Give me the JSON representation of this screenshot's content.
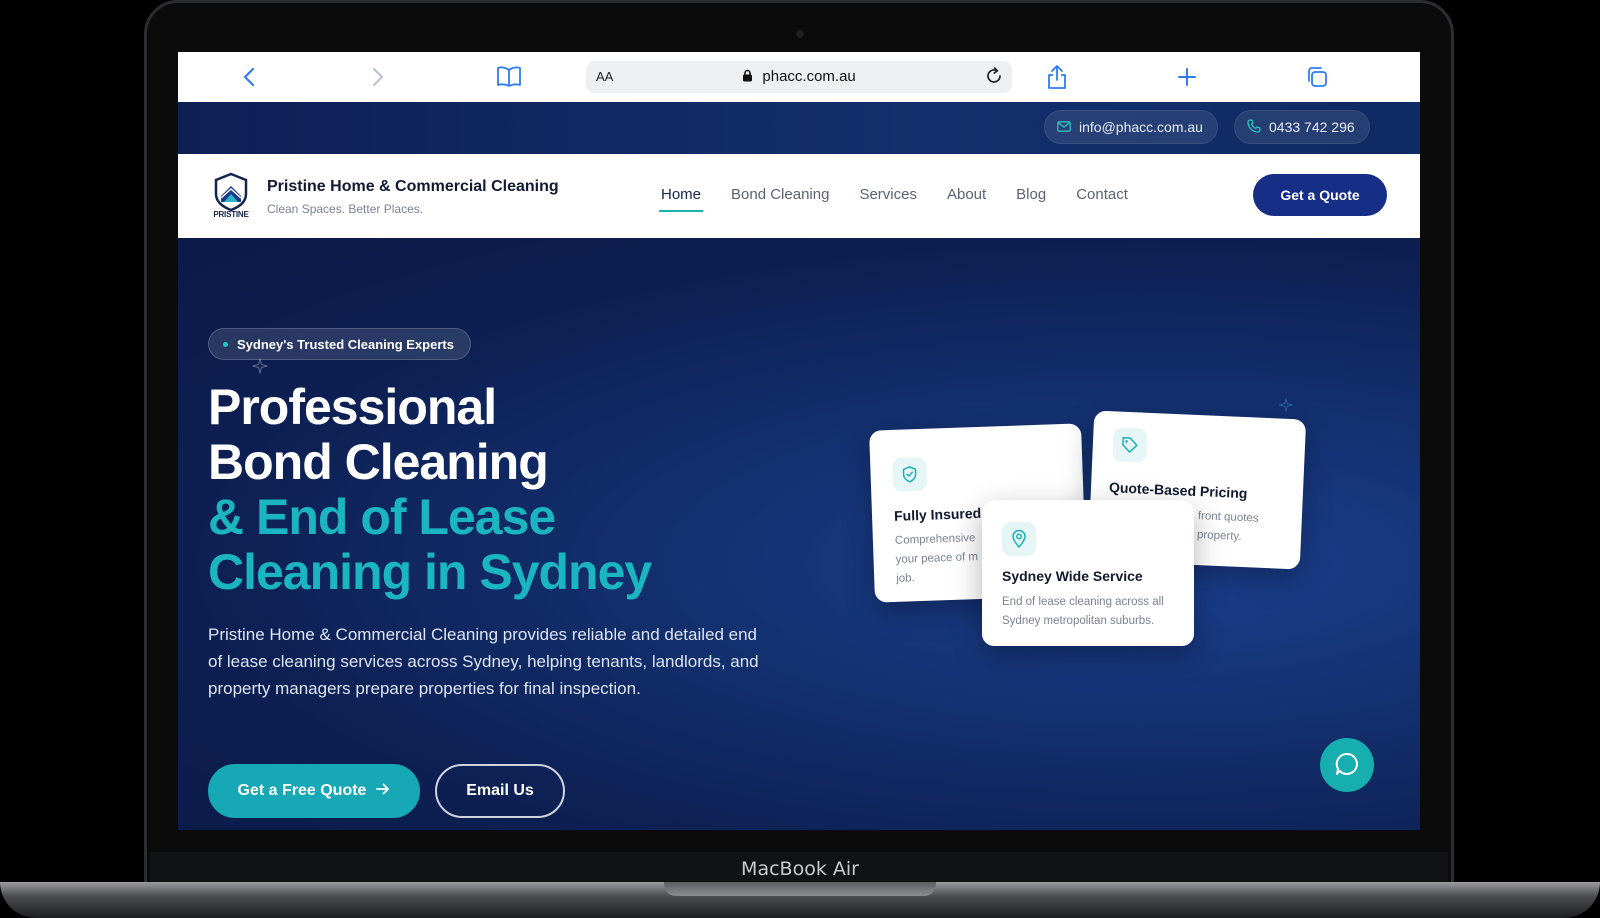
{
  "device": {
    "label": "MacBook Air"
  },
  "browser": {
    "aa_label": "AA",
    "url": "phacc.com.au"
  },
  "topbar": {
    "email": "info@phacc.com.au",
    "phone": "0433 742 296"
  },
  "nav": {
    "brand": "Pristine Home & Commercial Cleaning",
    "tagline": "Clean Spaces. Better Places.",
    "logo_text": "PRISTINE",
    "items": [
      "Home",
      "Bond Cleaning",
      "Services",
      "About",
      "Blog",
      "Contact"
    ],
    "active_item": "Home",
    "cta": "Get a Quote"
  },
  "hero": {
    "badge": "Sydney's Trusted Cleaning Experts",
    "headline_white_1": "Professional",
    "headline_white_2": "Bond Cleaning",
    "headline_teal_1": "& End of Lease",
    "headline_teal_2": "Cleaning in Sydney",
    "description": "Pristine Home & Commercial Cleaning provides reliable and detailed end of lease cleaning services across Sydney, helping tenants, landlords, and property managers prepare properties for final inspection.",
    "primary_cta": "Get a Free Quote",
    "secondary_cta": "Email Us"
  },
  "cards": {
    "insured": {
      "title": "Fully Insured",
      "line1": "Comprehensive",
      "line2": "your peace of m",
      "line3": "job.",
      "icon": "shield-check-icon"
    },
    "pricing": {
      "title": "Quote-Based Pricing",
      "line1": "front quotes",
      "line2": "property.",
      "icon": "tag-icon"
    },
    "sydney": {
      "title": "Sydney Wide Service",
      "line1": "End of lease cleaning across all",
      "line2": "Sydney metropolitan suburbs.",
      "icon": "map-pin-icon"
    }
  },
  "colors": {
    "navy": "#162e86",
    "teal": "#1ab5c0",
    "hero_bg": "#0d1f52"
  }
}
